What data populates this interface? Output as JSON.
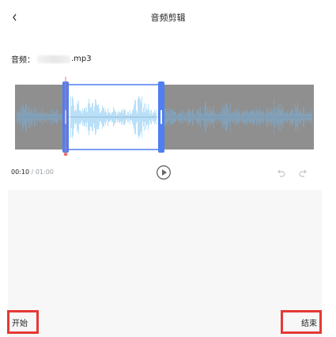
{
  "header": {
    "title": "音频剪辑",
    "back_icon": "chevron-left-icon"
  },
  "file": {
    "label": "音频：",
    "name_suffix": ".mp3"
  },
  "player": {
    "current_time": "00:10",
    "separator": " / ",
    "total_time": "01:00",
    "selection_start_fraction": 0.17,
    "selection_end_fraction": 0.49,
    "playhead_fraction": 0.17,
    "play_icon": "play-circle-icon",
    "undo_icon": "undo-icon",
    "redo_icon": "redo-icon"
  },
  "footer": {
    "start_label": "开始",
    "end_label": "结束"
  },
  "colors": {
    "accent": "#4f7ff0",
    "selection_wave": "#9dd3f5",
    "wave_gray_bg": "#8f8f8f",
    "wave_unselected": "#7fa7c7",
    "highlight_box": "#e53935",
    "playhead": "#ef6f6f"
  }
}
